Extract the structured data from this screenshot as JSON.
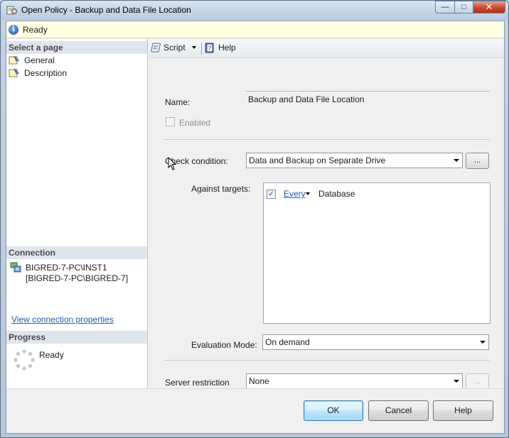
{
  "window": {
    "title": "Open Policy - Backup and Data File Location",
    "buttons": {
      "minimize": "—",
      "maximize": "□",
      "close": "✕"
    }
  },
  "status": {
    "text": "Ready",
    "icon": "info-icon"
  },
  "sidebar": {
    "select_page_header": "Select a page",
    "pages": [
      {
        "label": "General",
        "icon": "page-icon",
        "selected": true
      },
      {
        "label": "Description",
        "icon": "page-icon",
        "selected": false
      }
    ],
    "connection_header": "Connection",
    "connection_server": "BIGRED-7-PC\\INST1",
    "connection_user": "[BIGRED-7-PC\\BIGRED-7]",
    "connection_link": "View connection properties",
    "progress_header": "Progress",
    "progress_status": "Ready"
  },
  "toolbar": {
    "script_label": "Script",
    "help_label": "Help"
  },
  "form": {
    "name_label": "Name:",
    "name_value": "Backup and Data File Location",
    "enabled_label": "Enabled",
    "enabled_checked": false,
    "check_condition_label": "Check condition:",
    "check_condition_value": "Data and Backup on Separate Drive",
    "ellipsis_label": "...",
    "against_targets_label": "Against targets:",
    "target_qualifier": "Every",
    "target_object": "Database",
    "target_checked": true,
    "evaluation_mode_label": "Evaluation Mode:",
    "evaluation_mode_value": "On demand",
    "server_restriction_label": "Server restriction",
    "server_restriction_value": "None"
  },
  "footer": {
    "ok_label": "OK",
    "cancel_label": "Cancel",
    "help_label": "Help"
  },
  "colors": {
    "link": "#1c5fb0",
    "status_bg": "#ffffe1",
    "section_header_bg": "#dfe5ec"
  }
}
